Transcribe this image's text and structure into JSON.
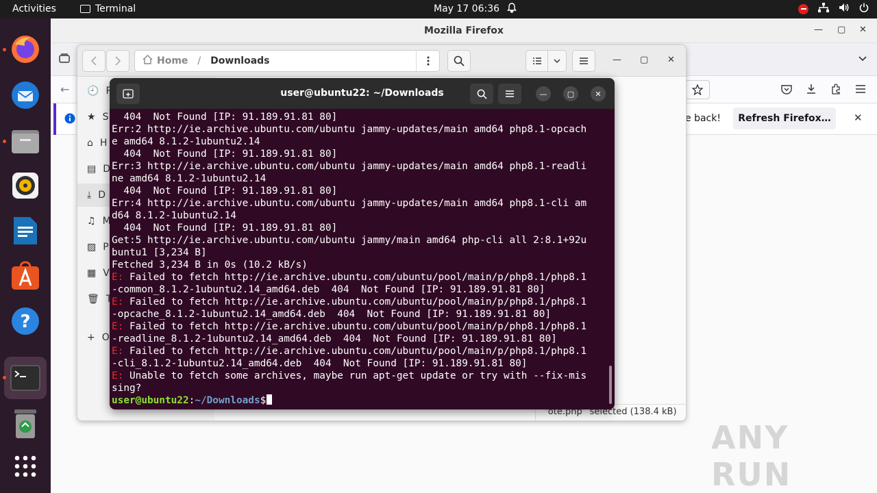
{
  "topbar": {
    "activities": "Activities",
    "app_name": "Terminal",
    "clock": "May 17  06:36"
  },
  "dock": {
    "items": [
      {
        "name": "firefox",
        "active": true
      },
      {
        "name": "thunderbird",
        "active": false
      },
      {
        "name": "files",
        "active": true
      },
      {
        "name": "rhythmbox",
        "active": false
      },
      {
        "name": "libreoffice-writer",
        "active": false
      },
      {
        "name": "app-center",
        "active": false
      },
      {
        "name": "help",
        "active": false
      },
      {
        "name": "terminal",
        "active": true
      },
      {
        "name": "trash",
        "active": false
      },
      {
        "name": "show-apps",
        "active": false
      }
    ]
  },
  "firefox": {
    "window_title": "Mozilla Firefox",
    "notice_text": "e back!",
    "refresh_button": "Refresh Firefox…"
  },
  "files": {
    "path_home": "Home",
    "path_current": "Downloads",
    "sidebar_fragments": [
      "R",
      "S",
      "H",
      "D",
      "D",
      "M",
      "P",
      "V",
      "T",
      "O"
    ],
    "status": "“ote.php” selected  (138.4 kB)"
  },
  "terminal": {
    "title": "user@ubuntu22: ~/Downloads",
    "lines": [
      {
        "t": "n",
        "text": "  404  Not Found [IP: 91.189.91.81 80]"
      },
      {
        "t": "n",
        "text": "Err:2 http://ie.archive.ubuntu.com/ubuntu jammy-updates/main amd64 php8.1-opcach"
      },
      {
        "t": "n",
        "text": "e amd64 8.1.2-1ubuntu2.14"
      },
      {
        "t": "n",
        "text": "  404  Not Found [IP: 91.189.91.81 80]"
      },
      {
        "t": "n",
        "text": "Err:3 http://ie.archive.ubuntu.com/ubuntu jammy-updates/main amd64 php8.1-readli"
      },
      {
        "t": "n",
        "text": "ne amd64 8.1.2-1ubuntu2.14"
      },
      {
        "t": "n",
        "text": "  404  Not Found [IP: 91.189.91.81 80]"
      },
      {
        "t": "n",
        "text": "Err:4 http://ie.archive.ubuntu.com/ubuntu jammy-updates/main amd64 php8.1-cli am"
      },
      {
        "t": "n",
        "text": "d64 8.1.2-1ubuntu2.14"
      },
      {
        "t": "n",
        "text": "  404  Not Found [IP: 91.189.91.81 80]"
      },
      {
        "t": "n",
        "text": "Get:5 http://ie.archive.ubuntu.com/ubuntu jammy/main amd64 php-cli all 2:8.1+92u"
      },
      {
        "t": "n",
        "text": "buntu1 [3,234 B]"
      },
      {
        "t": "n",
        "text": "Fetched 3,234 B in 0s (10.2 kB/s)"
      },
      {
        "t": "e",
        "prefix": "E:",
        "text": " Failed to fetch http://ie.archive.ubuntu.com/ubuntu/pool/main/p/php8.1/php8.1"
      },
      {
        "t": "n",
        "text": "-common_8.1.2-1ubuntu2.14_amd64.deb  404  Not Found [IP: 91.189.91.81 80]"
      },
      {
        "t": "e",
        "prefix": "E:",
        "text": " Failed to fetch http://ie.archive.ubuntu.com/ubuntu/pool/main/p/php8.1/php8.1"
      },
      {
        "t": "n",
        "text": "-opcache_8.1.2-1ubuntu2.14_amd64.deb  404  Not Found [IP: 91.189.91.81 80]"
      },
      {
        "t": "e",
        "prefix": "E:",
        "text": " Failed to fetch http://ie.archive.ubuntu.com/ubuntu/pool/main/p/php8.1/php8.1"
      },
      {
        "t": "n",
        "text": "-readline_8.1.2-1ubuntu2.14_amd64.deb  404  Not Found [IP: 91.189.91.81 80]"
      },
      {
        "t": "e",
        "prefix": "E:",
        "text": " Failed to fetch http://ie.archive.ubuntu.com/ubuntu/pool/main/p/php8.1/php8.1"
      },
      {
        "t": "n",
        "text": "-cli_8.1.2-1ubuntu2.14_amd64.deb  404  Not Found [IP: 91.189.91.81 80]"
      },
      {
        "t": "e",
        "prefix": "E:",
        "text": " Unable to fetch some archives, maybe run apt-get update or try with --fix-mis"
      },
      {
        "t": "n",
        "text": "sing?"
      }
    ],
    "prompt_user": "user@ubuntu22",
    "prompt_sep": ":",
    "prompt_dir": "~/Downloads",
    "prompt_end": "$"
  },
  "watermark": "ANY RUN",
  "colors": {
    "terminal_bg": "#300a24",
    "error_red": "#ef2929",
    "prompt_green": "#8ae234",
    "prompt_blue": "#729fcf",
    "dock_bg": "#2b1a2a",
    "accent_orange": "#e95420"
  }
}
